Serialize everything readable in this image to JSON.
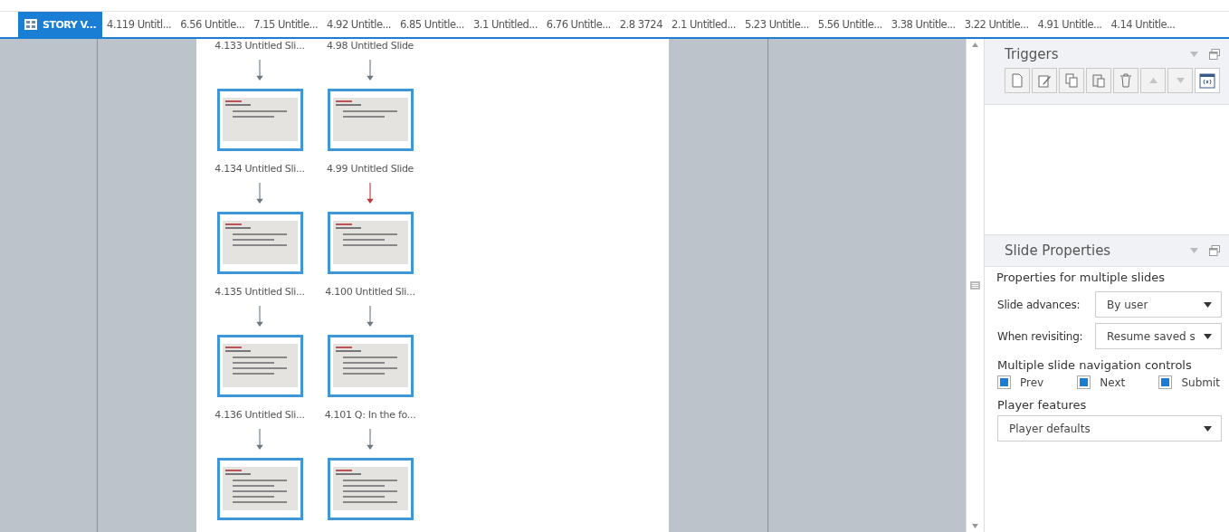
{
  "tabs": [
    {
      "label": "STORY V...",
      "selected": true,
      "kind": "story"
    },
    {
      "label": "4.119 Untitl...",
      "selected": false,
      "kind": "scene"
    },
    {
      "label": "6.56 Untitle...",
      "selected": false,
      "kind": "scene"
    },
    {
      "label": "7.15 Untitle...",
      "selected": false,
      "kind": "scene"
    },
    {
      "label": "4.92 Untitle...",
      "selected": false,
      "kind": "scene"
    },
    {
      "label": "6.85 Untitle...",
      "selected": false,
      "kind": "scene"
    },
    {
      "label": "3.1 Untitled...",
      "selected": false,
      "kind": "scene"
    },
    {
      "label": "6.76 Untitle...",
      "selected": false,
      "kind": "scene"
    },
    {
      "label": "2.8 3724",
      "selected": false,
      "kind": "scene"
    },
    {
      "label": "2.1 Untitled...",
      "selected": false,
      "kind": "scene"
    },
    {
      "label": "5.23 Untitle...",
      "selected": false,
      "kind": "scene"
    },
    {
      "label": "5.56 Untitle...",
      "selected": false,
      "kind": "scene"
    },
    {
      "label": "3.38 Untitle...",
      "selected": false,
      "kind": "scene"
    },
    {
      "label": "3.22 Untitle...",
      "selected": false,
      "kind": "scene"
    },
    {
      "label": "4.91 Untitle...",
      "selected": false,
      "kind": "scene"
    },
    {
      "label": "4.14 Untitle...",
      "selected": false,
      "kind": "scene"
    }
  ],
  "story_columns": [
    [
      {
        "label": "4.133 Untitled Sli...",
        "highlighted": false
      },
      {
        "label": "4.134 Untitled Sli...",
        "highlighted": false
      },
      {
        "label": "4.135 Untitled Sli...",
        "highlighted": false
      },
      {
        "label": "4.136 Untitled Sli...",
        "highlighted": false
      }
    ],
    [
      {
        "label": "4.98 Untitled Slide",
        "highlighted": false
      },
      {
        "label": "4.99 Untitled Slide",
        "highlighted": true
      },
      {
        "label": "4.100 Untitled Sli...",
        "highlighted": false
      },
      {
        "label": "4.101 Q: In the fo...",
        "highlighted": false
      }
    ]
  ],
  "triggers": {
    "title": "Triggers",
    "tools": [
      {
        "kind": "new",
        "disabled": false
      },
      {
        "kind": "edit",
        "disabled": false
      },
      {
        "kind": "copy",
        "disabled": false
      },
      {
        "kind": "paste",
        "disabled": false
      },
      {
        "kind": "delete",
        "disabled": false
      },
      {
        "kind": "up",
        "disabled": true
      },
      {
        "kind": "down",
        "disabled": true
      },
      {
        "kind": "variables",
        "disabled": false
      }
    ]
  },
  "slide_properties": {
    "title": "Slide Properties",
    "subtitle": "Properties for multiple slides",
    "fields": [
      {
        "label": "Slide advances:",
        "value": "By user"
      },
      {
        "label": "When revisiting:",
        "value": "Resume saved s"
      }
    ],
    "nav_heading": "Multiple slide navigation controls",
    "nav_controls": [
      {
        "label": "Prev",
        "checked": true
      },
      {
        "label": "Next",
        "checked": true
      },
      {
        "label": "Submit",
        "checked": true
      }
    ],
    "player_heading": "Player features",
    "player_value": "Player defaults"
  }
}
